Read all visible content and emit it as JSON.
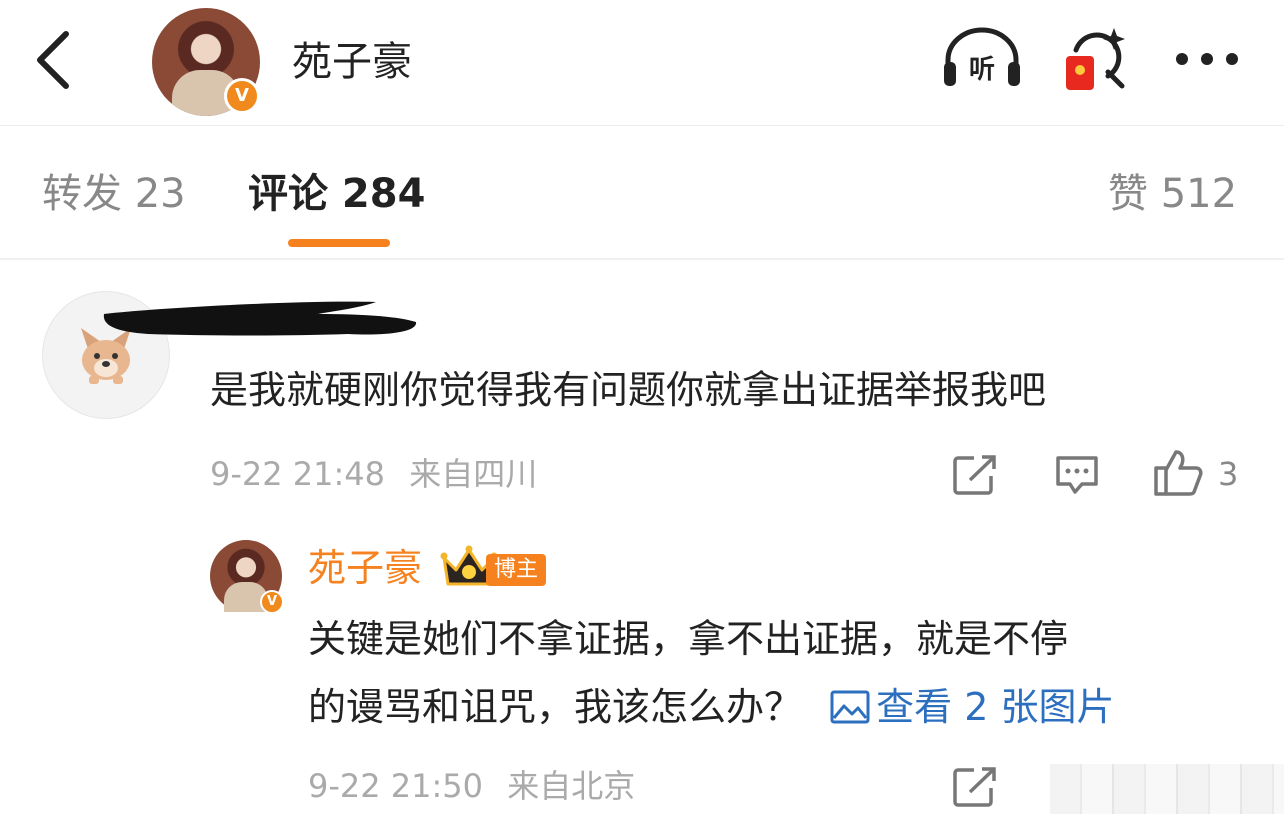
{
  "header": {
    "title": "苑子豪",
    "listen_label": "听",
    "verified_badge": "V",
    "icons": [
      "back-arrow-icon",
      "listen-icon",
      "red-packet-search-icon",
      "more-dots-icon"
    ]
  },
  "tabs": [
    {
      "label": "转发 23"
    },
    {
      "label": "评论 284",
      "active": true
    },
    {
      "label": "赞 512"
    }
  ],
  "comments": [
    {
      "username": "",
      "text": "是我就硬刚你觉得我有问题你就拿出证据举报我吧",
      "time": "9-22 21:48",
      "location": "来自四川",
      "likes": "3",
      "replies": [
        {
          "username": "苑子豪",
          "badge": "博主",
          "verified_badge": "V",
          "text_line1": "关键是她们不拿证据，拿不出证据，就是不停",
          "text_line2": "的谩骂和诅咒，我该怎么办？",
          "view_pictures": "查看 2 张图片",
          "time": "9-22 21:50",
          "location": "来自北京"
        }
      ]
    }
  ],
  "colors": {
    "accent": "#f5821f",
    "link": "#2d6fbf",
    "meta_text": "#aaaaaa"
  }
}
